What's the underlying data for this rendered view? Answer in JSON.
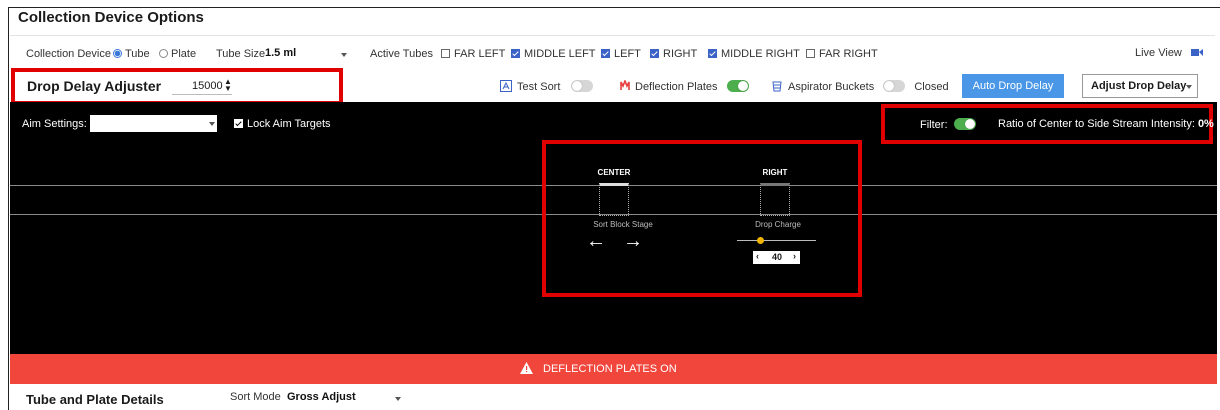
{
  "header": {
    "title": "Collection Device Options"
  },
  "device_row": {
    "collection_device_label": "Collection Device",
    "tube_label": "Tube",
    "plate_label": "Plate",
    "tube_size_label": "Tube Size",
    "tube_size_value": "1.5 ml",
    "active_tubes_label": "Active Tubes",
    "tubes": [
      {
        "label": "FAR LEFT",
        "checked": false
      },
      {
        "label": "MIDDLE LEFT",
        "checked": true
      },
      {
        "label": "LEFT",
        "checked": true
      },
      {
        "label": "RIGHT",
        "checked": true
      },
      {
        "label": "MIDDLE RIGHT",
        "checked": true
      },
      {
        "label": "FAR RIGHT",
        "checked": false
      }
    ],
    "live_view_label": "Live View"
  },
  "drop_delay": {
    "label": "Drop Delay Adjuster",
    "value": "15000"
  },
  "controls": {
    "test_sort_label": "Test Sort",
    "deflection_plates_label": "Deflection Plates",
    "aspirator_buckets_label": "Aspirator Buckets",
    "closed_label": "Closed",
    "auto_drop_delay_label": "Auto Drop Delay",
    "adjust_drop_delay_label": "Adjust Drop Delay"
  },
  "aim": {
    "settings_label": "Aim Settings:",
    "settings_value": "",
    "lock_label": "Lock Aim Targets",
    "filter_label": "Filter:",
    "ratio_label": "Ratio of Center to Side Stream Intensity:",
    "ratio_value": "0%"
  },
  "stage": {
    "center_label": "CENTER",
    "right_label": "RIGHT",
    "sort_block_label": "Sort Block Stage",
    "drop_charge_label": "Drop Charge",
    "drop_charge_value": "40",
    "drop_charge_fraction": 0.3
  },
  "banner": {
    "text": "DEFLECTION PLATES ON"
  },
  "footer": {
    "title": "Tube and Plate Details",
    "sort_mode_label": "Sort Mode",
    "sort_mode_value": "Gross Adjust"
  },
  "colors": {
    "accent_red": "#e10000",
    "banner": "#f0463c",
    "button_blue": "#4a97e8",
    "toggle_green": "#4cae4c"
  }
}
